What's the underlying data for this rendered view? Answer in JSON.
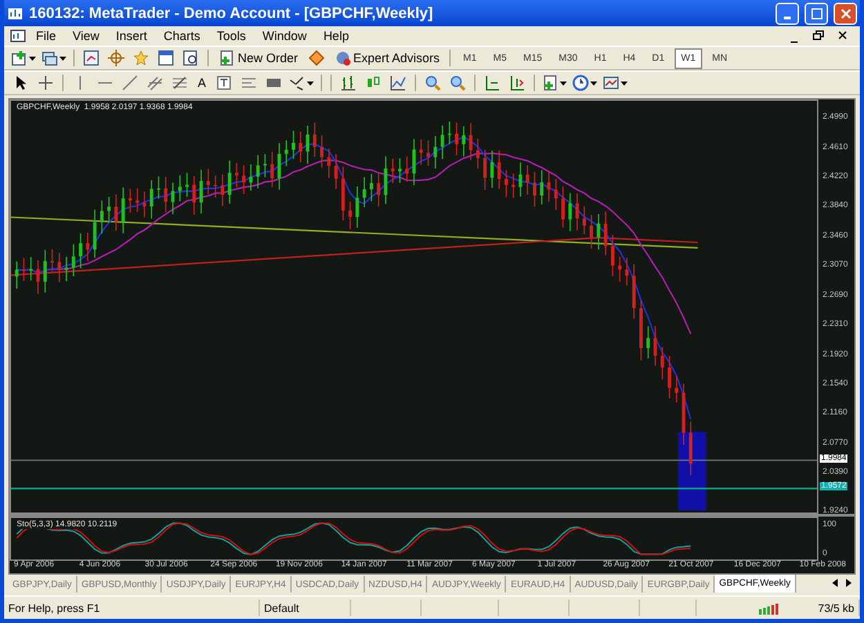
{
  "window": {
    "title": "160132: MetaTrader - Demo Account - [GBPCHF,Weekly]"
  },
  "menu": [
    "File",
    "View",
    "Insert",
    "Charts",
    "Tools",
    "Window",
    "Help"
  ],
  "toolbar": {
    "new_order": "New Order",
    "expert_advisors": "Expert Advisors",
    "timeframes": [
      {
        "label": "M1",
        "selected": false
      },
      {
        "label": "M5",
        "selected": false
      },
      {
        "label": "M15",
        "selected": false
      },
      {
        "label": "M30",
        "selected": false
      },
      {
        "label": "H1",
        "selected": false
      },
      {
        "label": "H4",
        "selected": false
      },
      {
        "label": "D1",
        "selected": false
      },
      {
        "label": "W1",
        "selected": true
      },
      {
        "label": "MN",
        "selected": false
      }
    ],
    "text_tool": "A"
  },
  "chart": {
    "header": "GBPCHF,Weekly  1.9958 2.0197 1.9368 1.9984",
    "price_labels": [
      "2.4990",
      "2.4610",
      "2.4220",
      "2.3840",
      "2.3460",
      "2.3070",
      "2.2690",
      "2.2310",
      "2.1920",
      "2.1540",
      "2.1160",
      "2.0770",
      "2.0390",
      "1.9240"
    ],
    "bid_tag": "1.9984",
    "line_tag": "1.9572",
    "indicator": {
      "header": "Sto(5,3,3) 14.9820 10.2119",
      "axis": [
        "100",
        "0"
      ]
    },
    "time_labels": [
      "9 Apr 2006",
      "4 Jun 2006",
      "30 Jul 2006",
      "24 Sep 2006",
      "19 Nov 2006",
      "14 Jan 2007",
      "11 Mar 2007",
      "6 May 2007",
      "1 Jul 2007",
      "26 Aug 2007",
      "21 Oct 2007",
      "16 Dec 2007",
      "10 Feb 2008"
    ]
  },
  "tabs": [
    {
      "label": "GBPJPY,Daily",
      "selected": false
    },
    {
      "label": "GBPUSD,Monthly",
      "selected": false
    },
    {
      "label": "USDJPY,Daily",
      "selected": false
    },
    {
      "label": "EURJPY,H4",
      "selected": false
    },
    {
      "label": "USDCAD,Daily",
      "selected": false
    },
    {
      "label": "NZDUSD,H4",
      "selected": false
    },
    {
      "label": "AUDJPY,Weekly",
      "selected": false
    },
    {
      "label": "EURAUD,H4",
      "selected": false
    },
    {
      "label": "AUDUSD,Daily",
      "selected": false
    },
    {
      "label": "EURGBP,Daily",
      "selected": false
    },
    {
      "label": "GBPCHF,Weekly",
      "selected": true
    }
  ],
  "status_bar": {
    "help": "For Help, press F1",
    "profile": "Default",
    "traffic": "73/5 kb"
  }
}
